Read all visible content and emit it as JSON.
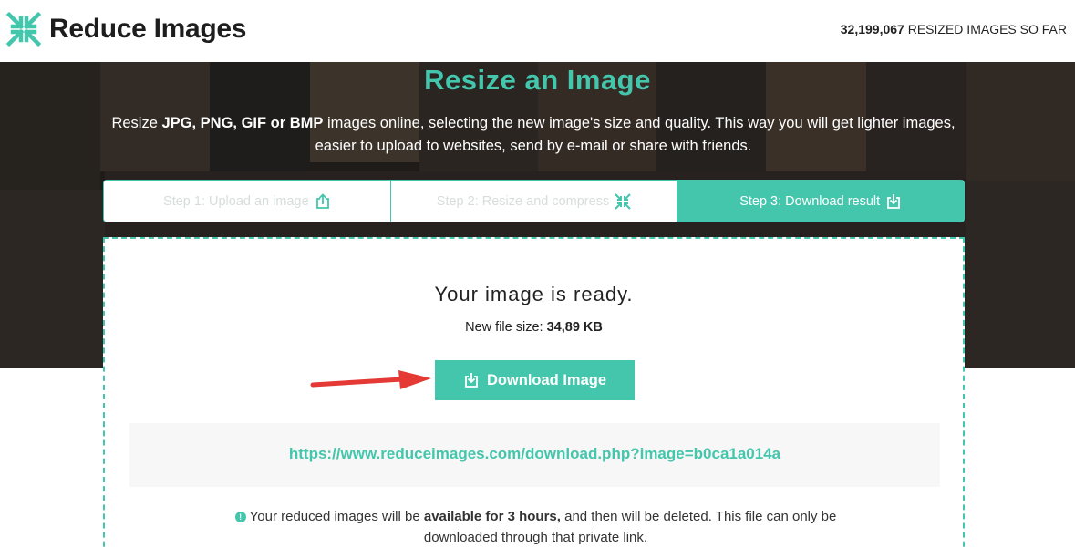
{
  "header": {
    "logo_text": "Reduce Images",
    "counter_number": "32,199,067",
    "counter_suffix": " RESIZED IMAGES SO FAR"
  },
  "hero": {
    "title": "Resize an Image",
    "desc_1": "Resize ",
    "desc_formats": "JPG, PNG, GIF or BMP",
    "desc_2": " images online, selecting the new image's size and quality. This way you will get lighter images, easier to upload to websites, send by e-mail or share with friends."
  },
  "steps": [
    {
      "label": "Step 1: Upload an image",
      "icon": "upload-icon",
      "active": false
    },
    {
      "label": "Step 2: Resize and compress",
      "icon": "compress-icon",
      "active": false
    },
    {
      "label": "Step 3: Download result",
      "icon": "download-icon",
      "active": true
    }
  ],
  "result": {
    "ready_text": "Your image is ready.",
    "size_label": "New file size: ",
    "size_value": "34,89 KB",
    "download_label": "Download Image",
    "link_text": "https://www.reduceimages.com/download.php?image=b0ca1a014a",
    "note_1": "Your reduced images will be ",
    "note_bold": "available for 3 hours,",
    "note_2": " and then will be deleted. This file can only be downloaded through that private link."
  },
  "colors": {
    "accent": "#43c6ac",
    "arrow": "#e53935"
  }
}
